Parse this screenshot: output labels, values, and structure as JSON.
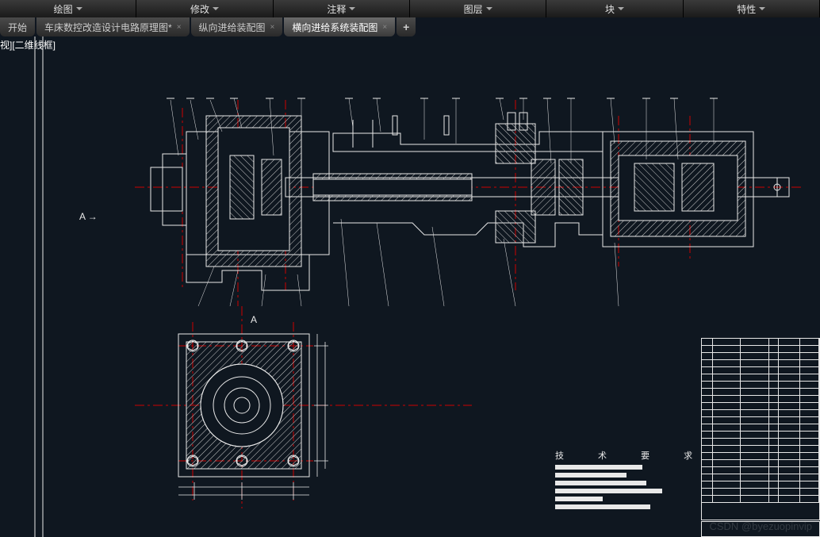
{
  "menu": {
    "items": [
      "绘图",
      "修改",
      "注释",
      "图层",
      "块",
      "特性"
    ]
  },
  "tabs": {
    "items": [
      {
        "label": "开始",
        "active": false
      },
      {
        "label": "车床数控改造设计电路原理图*",
        "active": false
      },
      {
        "label": "纵向进给装配图",
        "active": false
      },
      {
        "label": "横向进给系统装配图",
        "active": true
      }
    ],
    "new": "+"
  },
  "view": {
    "label": "视][二维线框]"
  },
  "markers": {
    "a": "A",
    "arrow": "→"
  },
  "requirements": {
    "title": "技 术 要 求"
  },
  "watermark": "CSDN @byezuopinvip",
  "colors": {
    "bg": "#0f1720",
    "line_white": "#e8e8e8",
    "line_red": "#cc0000",
    "hatch": "#c8c8c8"
  }
}
